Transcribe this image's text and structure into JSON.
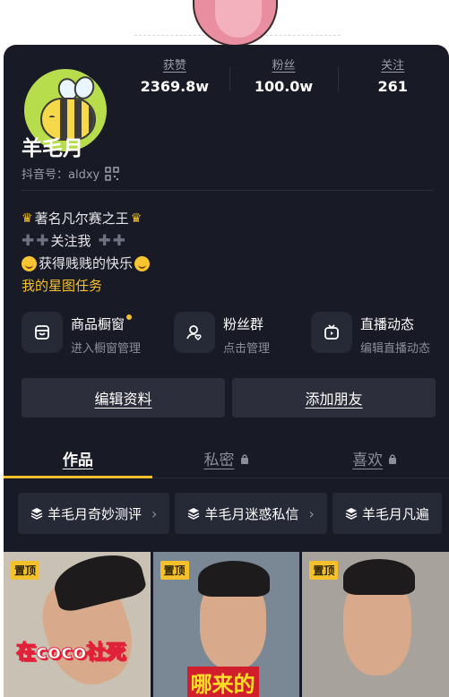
{
  "stats": [
    {
      "label": "获赞",
      "value": "2369.8w"
    },
    {
      "label": "粉丝",
      "value": "100.0w"
    },
    {
      "label": "关注",
      "value": "261"
    }
  ],
  "profile": {
    "name": "羊毛月",
    "douyin_id": "抖音号：aldxy"
  },
  "bio": {
    "line1": "著名凡尔赛之王",
    "line2": "关注我",
    "line3": "获得贱贱的快乐",
    "task_link": "我的星图任务"
  },
  "features": [
    {
      "title": "商品橱窗",
      "subtitle": "进入橱窗管理",
      "icon": "storefront-icon"
    },
    {
      "title": "粉丝群",
      "subtitle": "点击管理",
      "icon": "fan-group-icon"
    },
    {
      "title": "直播动态",
      "subtitle": "编辑直播动态",
      "icon": "live-tv-icon"
    }
  ],
  "actions": {
    "edit_profile": "编辑资料",
    "add_friend": "添加朋友"
  },
  "tabs": [
    {
      "label": "作品",
      "active": true
    },
    {
      "label": "私密",
      "locked": true
    },
    {
      "label": "喜欢",
      "locked": true
    }
  ],
  "collections": [
    {
      "label": "羊毛月奇妙测评"
    },
    {
      "label": "羊毛月迷惑私信"
    },
    {
      "label": "羊毛月凡遍"
    }
  ],
  "videos": [
    {
      "badge": "置顶",
      "caption": "在coco社死"
    },
    {
      "badge": "置顶",
      "caption": "哪来的"
    },
    {
      "badge": "置顶",
      "caption": ""
    }
  ],
  "colors": {
    "background": "#181a25",
    "accent": "#f4c12c",
    "muted": "#9a9ca8"
  }
}
